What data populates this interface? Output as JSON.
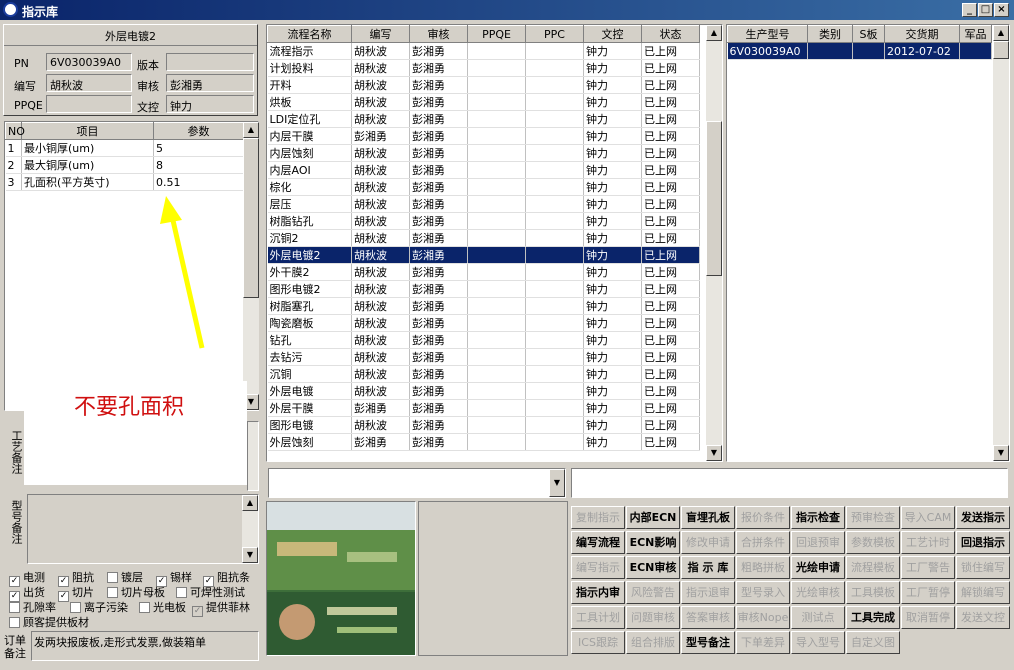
{
  "window": {
    "title": "指示库",
    "min": "_",
    "max": "□",
    "close": "×"
  },
  "left": {
    "header": "外层电镀2",
    "pn_label": "PN",
    "pn_value": "6V030039A0",
    "version_label": "版本",
    "version_value": "",
    "writer_label": "编写",
    "writer_value": "胡秋波",
    "reviewer_label": "审核",
    "reviewer_value": "彭湘勇",
    "ppqe_label": "PPQE",
    "ppqe_value": "",
    "control_label": "文控",
    "control_value": "钟力",
    "params": {
      "headers": [
        "NO",
        "项目",
        "参数"
      ],
      "rows": [
        [
          "1",
          "最小铜厚(um)",
          "5"
        ],
        [
          "2",
          "最大铜厚(um)",
          "8"
        ],
        [
          "3",
          "孔面积(平方英寸)",
          "0.51"
        ]
      ]
    },
    "annotation": "不要孔面积",
    "process_note_label": "工艺备注",
    "model_note_label": "型号备注",
    "checkboxes": [
      {
        "label": "电测",
        "checked": true
      },
      {
        "label": "阻抗",
        "checked": true
      },
      {
        "label": "镀层",
        "checked": false
      },
      {
        "label": "锡样",
        "checked": true
      },
      {
        "label": "阻抗条",
        "checked": true
      },
      {
        "label": "出货",
        "checked": true
      },
      {
        "label": "切片",
        "checked": true
      },
      {
        "label": "切片母板",
        "checked": false
      },
      {
        "label": "可焊性测试",
        "checked": false
      },
      {
        "label": "孔隙率",
        "checked": false
      },
      {
        "label": "离子污染",
        "checked": false
      },
      {
        "label": "光电板",
        "checked": false
      },
      {
        "label": "提供菲林",
        "checked": true
      },
      {
        "label": "顾客提供板材",
        "checked": false
      }
    ],
    "order_note_label": "订单备注",
    "order_note_value": "发两块报废板,走形式发票,做装箱单"
  },
  "process": {
    "headers": [
      "流程名称",
      "编写",
      "审核",
      "PPQE",
      "PPC",
      "文控",
      "状态"
    ],
    "rows": [
      [
        "流程指示",
        "胡秋波",
        "彭湘勇",
        "",
        "",
        "钟力",
        "已上网"
      ],
      [
        "计划投料",
        "胡秋波",
        "彭湘勇",
        "",
        "",
        "钟力",
        "已上网"
      ],
      [
        "开料",
        "胡秋波",
        "彭湘勇",
        "",
        "",
        "钟力",
        "已上网"
      ],
      [
        "烘板",
        "胡秋波",
        "彭湘勇",
        "",
        "",
        "钟力",
        "已上网"
      ],
      [
        "LDI定位孔",
        "胡秋波",
        "彭湘勇",
        "",
        "",
        "钟力",
        "已上网"
      ],
      [
        "内层干膜",
        "彭湘勇",
        "彭湘勇",
        "",
        "",
        "钟力",
        "已上网"
      ],
      [
        "内层蚀刻",
        "胡秋波",
        "彭湘勇",
        "",
        "",
        "钟力",
        "已上网"
      ],
      [
        "内层AOI",
        "胡秋波",
        "彭湘勇",
        "",
        "",
        "钟力",
        "已上网"
      ],
      [
        "棕化",
        "胡秋波",
        "彭湘勇",
        "",
        "",
        "钟力",
        "已上网"
      ],
      [
        "层压",
        "胡秋波",
        "彭湘勇",
        "",
        "",
        "钟力",
        "已上网"
      ],
      [
        "树脂钻孔",
        "胡秋波",
        "彭湘勇",
        "",
        "",
        "钟力",
        "已上网"
      ],
      [
        "沉铜2",
        "胡秋波",
        "彭湘勇",
        "",
        "",
        "钟力",
        "已上网"
      ],
      [
        "外层电镀2",
        "胡秋波",
        "彭湘勇",
        "",
        "",
        "钟力",
        "已上网"
      ],
      [
        "外干膜2",
        "胡秋波",
        "彭湘勇",
        "",
        "",
        "钟力",
        "已上网"
      ],
      [
        "图形电镀2",
        "胡秋波",
        "彭湘勇",
        "",
        "",
        "钟力",
        "已上网"
      ],
      [
        "树脂塞孔",
        "胡秋波",
        "彭湘勇",
        "",
        "",
        "钟力",
        "已上网"
      ],
      [
        "陶瓷磨板",
        "胡秋波",
        "彭湘勇",
        "",
        "",
        "钟力",
        "已上网"
      ],
      [
        "钻孔",
        "胡秋波",
        "彭湘勇",
        "",
        "",
        "钟力",
        "已上网"
      ],
      [
        "去钻污",
        "胡秋波",
        "彭湘勇",
        "",
        "",
        "钟力",
        "已上网"
      ],
      [
        "沉铜",
        "胡秋波",
        "彭湘勇",
        "",
        "",
        "钟力",
        "已上网"
      ],
      [
        "外层电镀",
        "胡秋波",
        "彭湘勇",
        "",
        "",
        "钟力",
        "已上网"
      ],
      [
        "外层干膜",
        "彭湘勇",
        "彭湘勇",
        "",
        "",
        "钟力",
        "已上网"
      ],
      [
        "图形电镀",
        "胡秋波",
        "彭湘勇",
        "",
        "",
        "钟力",
        "已上网"
      ],
      [
        "外层蚀刻",
        "彭湘勇",
        "彭湘勇",
        "",
        "",
        "钟力",
        "已上网"
      ]
    ],
    "selected_index": 12
  },
  "product": {
    "headers": [
      "生产型号",
      "类别",
      "S板",
      "交货期",
      "军品"
    ],
    "rows": [
      [
        "6V030039A0",
        "",
        "",
        "2012-07-02",
        ""
      ]
    ]
  },
  "buttons": [
    {
      "label": "复制指示",
      "enabled": false
    },
    {
      "label": "内部ECN",
      "enabled": true
    },
    {
      "label": "盲埋孔板",
      "enabled": true
    },
    {
      "label": "报价条件",
      "enabled": false
    },
    {
      "label": "指示检查",
      "enabled": true
    },
    {
      "label": "预审检查",
      "enabled": false
    },
    {
      "label": "导入CAM",
      "enabled": false
    },
    {
      "label": "发送指示",
      "enabled": true
    },
    {
      "label": "编写流程",
      "enabled": true
    },
    {
      "label": "ECN影响",
      "enabled": true
    },
    {
      "label": "修改申请",
      "enabled": false
    },
    {
      "label": "合拼条件",
      "enabled": false
    },
    {
      "label": "回退预审",
      "enabled": false
    },
    {
      "label": "参数模板",
      "enabled": false
    },
    {
      "label": "工艺计时",
      "enabled": false
    },
    {
      "label": "回退指示",
      "enabled": true
    },
    {
      "label": "编写指示",
      "enabled": false
    },
    {
      "label": "ECN审核",
      "enabled": true
    },
    {
      "label": "指 示 库",
      "enabled": true
    },
    {
      "label": "粗略拼板",
      "enabled": false
    },
    {
      "label": "光绘申请",
      "enabled": true
    },
    {
      "label": "流程模板",
      "enabled": false
    },
    {
      "label": "工厂警告",
      "enabled": false
    },
    {
      "label": "锁住编写",
      "enabled": false
    },
    {
      "label": "指示内审",
      "enabled": true
    },
    {
      "label": "风险警告",
      "enabled": false
    },
    {
      "label": "指示退审",
      "enabled": false
    },
    {
      "label": "型号录入",
      "enabled": false
    },
    {
      "label": "光绘审核",
      "enabled": false
    },
    {
      "label": "工具模板",
      "enabled": false
    },
    {
      "label": "工厂暂停",
      "enabled": false
    },
    {
      "label": "解锁编写",
      "enabled": false
    },
    {
      "label": "工具计划",
      "enabled": false
    },
    {
      "label": "问题审核",
      "enabled": false
    },
    {
      "label": "答案审核",
      "enabled": false
    },
    {
      "label": "审核Nope",
      "enabled": false
    },
    {
      "label": "测试点",
      "enabled": false
    },
    {
      "label": "工具完成",
      "enabled": true
    },
    {
      "label": "取消暂停",
      "enabled": false
    },
    {
      "label": "发送文控",
      "enabled": false
    },
    {
      "label": "ICS跟踪",
      "enabled": false
    },
    {
      "label": "组合排版",
      "enabled": false
    },
    {
      "label": "型号备注",
      "enabled": true
    },
    {
      "label": "下单差异",
      "enabled": false
    },
    {
      "label": "导入型号",
      "enabled": false
    },
    {
      "label": "自定义图",
      "enabled": false
    }
  ],
  "colors": {
    "selection": "#0a246a",
    "annotation_text": "#d01010",
    "arrow": "#ffff00"
  }
}
